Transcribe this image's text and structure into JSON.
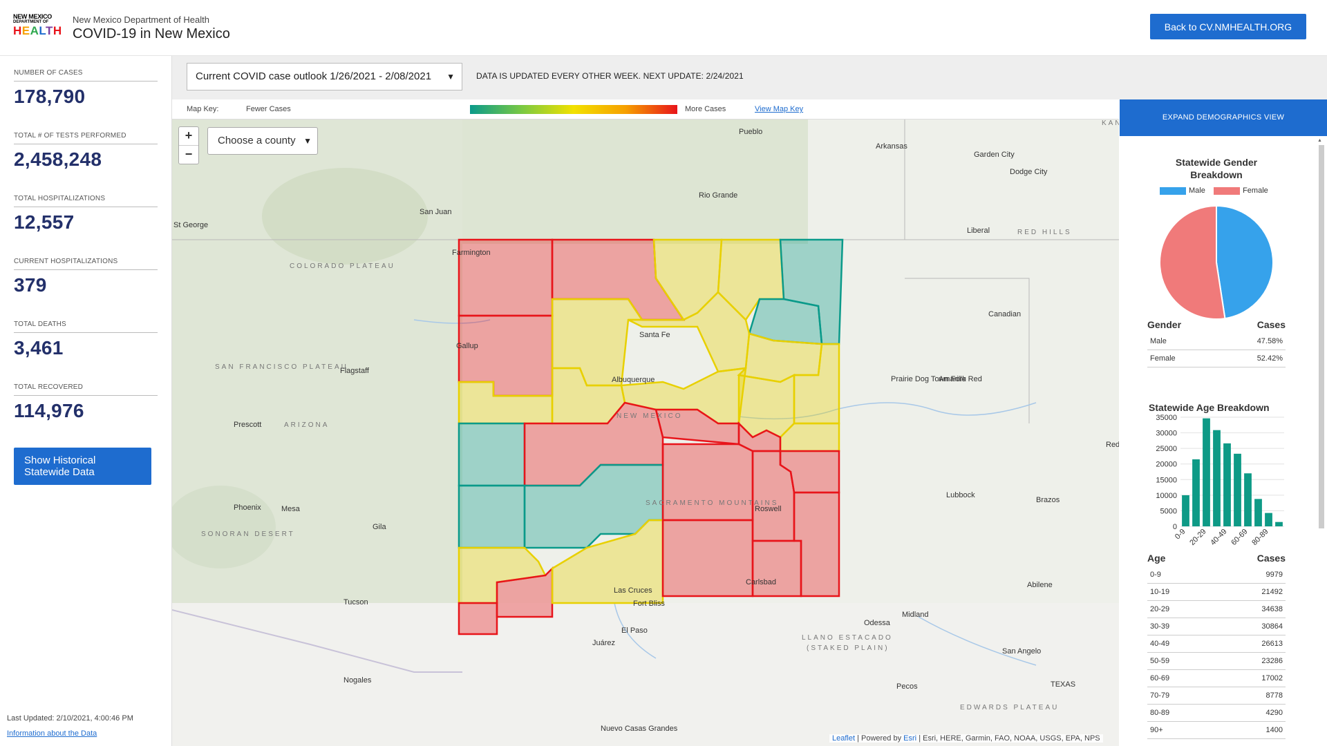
{
  "header": {
    "logo": {
      "line1": "NEW MEXICO",
      "line2": "DEPARTMENT OF",
      "line3": "HEALTH"
    },
    "department": "New Mexico Department of Health",
    "title": "COVID-19 in New Mexico",
    "back_button": "Back to CV.NMHEALTH.ORG"
  },
  "stats": [
    {
      "label": "NUMBER OF CASES",
      "value": "178,790"
    },
    {
      "label": "TOTAL # OF TESTS PERFORMED",
      "value": "2,458,248"
    },
    {
      "label": "TOTAL HOSPITALIZATIONS",
      "value": "12,557"
    },
    {
      "label": "CURRENT HOSPITALIZATIONS",
      "value": "379"
    },
    {
      "label": "TOTAL DEATHS",
      "value": "3,461"
    },
    {
      "label": "TOTAL RECOVERED",
      "value": "114,976"
    }
  ],
  "history_button": "Show Historical Statewide Data",
  "last_updated": "Last Updated: 2/10/2021, 4:00:46 PM",
  "about_link": "Information about the Data",
  "outlook_select": "Current COVID case outlook 1/26/2021 - 2/08/2021",
  "update_note": "DATA IS UPDATED EVERY OTHER WEEK. NEXT UPDATE: 2/24/2021",
  "map_key": {
    "label": "Map Key:",
    "fewer": "Fewer Cases",
    "more": "More Cases",
    "link": "View Map Key",
    "gradient_colors": [
      "#0a9a8a",
      "#7ac943",
      "#f2e100",
      "#f6a000",
      "#e8141a"
    ]
  },
  "map": {
    "zoom_in": "+",
    "zoom_out": "−",
    "county_select": "Choose a county",
    "place_labels": [
      "Pueblo",
      "Garden City",
      "Dodge City",
      "Liberal",
      "RED HILLS",
      "St George",
      "COLORADO PLATEAU",
      "Farmington",
      "Gallup",
      "Santa Fe",
      "Albuquerque",
      "NEW MEXICO",
      "Flagstaff",
      "Prescott",
      "ARIZONA",
      "Phoenix",
      "Mesa",
      "SONORAN DESERT",
      "Tucson",
      "Nogales",
      "Amarillo",
      "Lubbock",
      "Roswell",
      "Carlsbad",
      "Las Cruces",
      "El Paso",
      "Juárez",
      "Odessa",
      "Midland",
      "Abilene",
      "San Angelo",
      "TEXAS",
      "LLANO ESTACADO",
      "(STAKED PLAIN)",
      "EDWARDS PLATEAU",
      "Nuevo Casas Grandes",
      "SACRAMENTO MOUNTAINS",
      "SAN FRANCISCO PLATEAU",
      "Fort Bliss",
      "KANSAS",
      "Arkansas",
      "Canadian",
      "Pecos",
      "Brazos",
      "Red",
      "Gila",
      "Rio Grande",
      "San Juan",
      "Prairie Dog Town Fork Red"
    ],
    "attribution": {
      "leaflet": "Leaflet",
      "powered": "| Powered by",
      "esri": "Esri",
      "sources": "| Esri, HERE, Garmin, FAO, NOAA, USGS, EPA, NPS"
    },
    "county_colors": {
      "red": "#e8141a",
      "yellow": "#e8d000",
      "teal": "#0a9a8a"
    }
  },
  "demographics": {
    "expand_button": "EXPAND DEMOGRAPHICS VIEW",
    "gender_title": "Statewide Gender Breakdown",
    "gender_legend": [
      {
        "name": "Male",
        "color": "#36a2eb"
      },
      {
        "name": "Female",
        "color": "#f07a7a"
      }
    ],
    "gender_table": {
      "headers": [
        "Gender",
        "Cases"
      ],
      "rows": [
        {
          "label": "Male",
          "value": "47.58%"
        },
        {
          "label": "Female",
          "value": "52.42%"
        }
      ]
    },
    "age_title": "Statewide Age Breakdown",
    "age_table": {
      "headers": [
        "Age",
        "Cases"
      ],
      "rows": [
        {
          "label": "0-9",
          "value": "9979"
        },
        {
          "label": "10-19",
          "value": "21492"
        },
        {
          "label": "20-29",
          "value": "34638"
        },
        {
          "label": "30-39",
          "value": "30864"
        },
        {
          "label": "40-49",
          "value": "26613"
        },
        {
          "label": "50-59",
          "value": "23286"
        },
        {
          "label": "60-69",
          "value": "17002"
        },
        {
          "label": "70-79",
          "value": "8778"
        },
        {
          "label": "80-89",
          "value": "4290"
        },
        {
          "label": "90+",
          "value": "1400"
        }
      ]
    }
  },
  "chart_data": [
    {
      "type": "pie",
      "title": "Statewide Gender Breakdown",
      "categories": [
        "Male",
        "Female"
      ],
      "values": [
        47.58,
        52.42
      ],
      "colors": [
        "#36a2eb",
        "#f07a7a"
      ],
      "legend": "top"
    },
    {
      "type": "bar",
      "title": "Statewide Age Breakdown",
      "categories": [
        "0-9",
        "10-19",
        "20-29",
        "30-39",
        "40-49",
        "50-59",
        "60-69",
        "70-79",
        "80-89",
        "90+"
      ],
      "x_tick_labels": [
        "0-9",
        "20-29",
        "40-49",
        "60-69",
        "80-89"
      ],
      "values": [
        9979,
        21492,
        34638,
        30864,
        26613,
        23286,
        17002,
        8778,
        4290,
        1400
      ],
      "ylim": [
        0,
        35000
      ],
      "yticks": [
        0,
        5000,
        10000,
        15000,
        20000,
        25000,
        30000,
        35000
      ],
      "grid": true,
      "color": "#0e9a86"
    }
  ]
}
